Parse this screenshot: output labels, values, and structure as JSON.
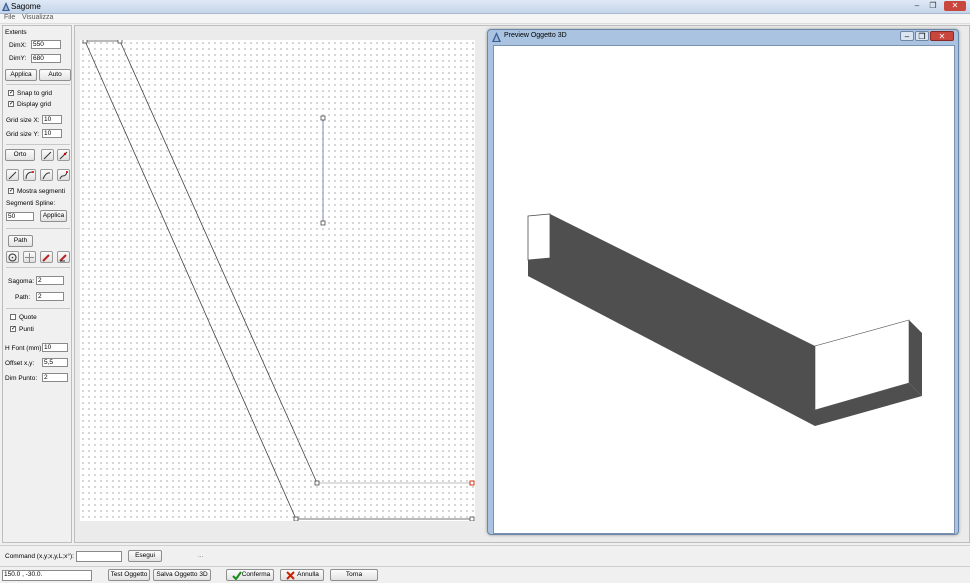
{
  "window": {
    "title": "Sagome",
    "controls": [
      "–",
      "❐",
      "✕"
    ]
  },
  "menu": [
    "File",
    "Visualizza"
  ],
  "left": {
    "extents_title": "Extents",
    "dimx_label": "DimX:",
    "dimx_value": "550",
    "dimy_label": "DimY:",
    "dimy_value": "680",
    "applica1": "Applica",
    "auto": "Auto",
    "snap_label": "Snap to grid",
    "snap_checked": "✓",
    "display_label": "Display grid",
    "display_checked": "✓",
    "gridx_label": "Grid size X:",
    "gridx_value": "10",
    "gridy_label": "Grid size Y:",
    "gridy_value": "10",
    "orto": "Orto",
    "mostra_label": "Mostra segmenti",
    "mostra_checked": "✓",
    "segspline_label": "Segmenti Spline:",
    "segspline_value": "50",
    "applica2": "Applica",
    "path_button": "Path",
    "sagoma_label": "Sagoma:",
    "sagoma_value": "2",
    "path_label": "Path:",
    "path_value": "2",
    "quote_label": "Quote",
    "quote_checked": "",
    "punti_label": "Punti",
    "punti_checked": "✓",
    "hfont_label": "H Font (mm):",
    "hfont_value": "10",
    "offset_label": "Offset x,y:",
    "offset_value": "5,5",
    "dimpunto_label": "Dim Punto:",
    "dimpunto_value": "2"
  },
  "preview": {
    "title": "Preview Oggetto 3D",
    "controls": [
      "–",
      "❐",
      "✕"
    ]
  },
  "command": {
    "label": "Command (x,y;x,y,L;x°):",
    "value": "",
    "esegui": "Esegui",
    "extra": "..."
  },
  "status": {
    "coords": "150.0 , -30.0.",
    "test": "Test Oggetto",
    "salva": "Salva Oggetto 3D",
    "conferma": "Conferma",
    "annulla": "Annulla",
    "torna": "Torna"
  },
  "colors": {
    "accent_red": "#cc2200",
    "check_green": "#1a8a1a",
    "solid_dark": "#4f4f4f"
  }
}
